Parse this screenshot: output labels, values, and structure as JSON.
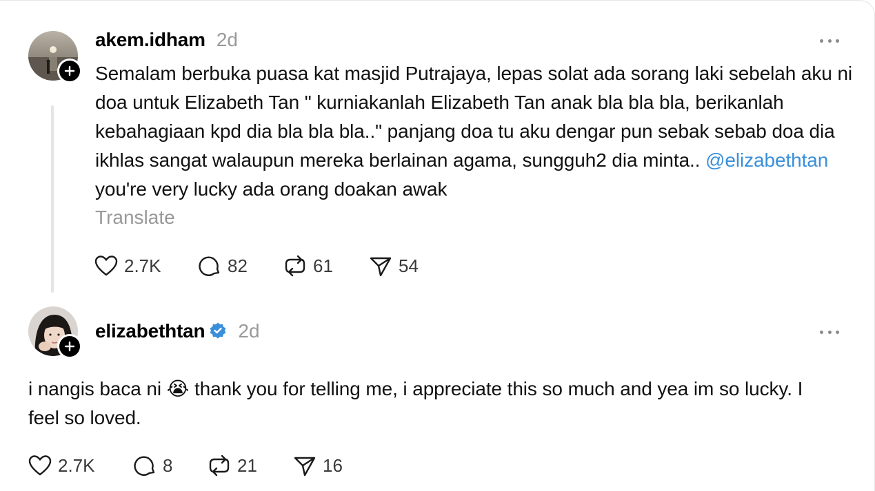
{
  "post1": {
    "username": "akem.idham",
    "time": "2d",
    "avatar_icon": "avatar-sunset-beach",
    "text_part1": "Semalam berbuka puasa kat masjid Putrajaya, lepas solat ada sorang laki sebelah aku ni doa untuk Elizabeth Tan \" kurniakanlah Elizabeth Tan anak bla bla bla, berikanlah kebahagiaan kpd dia bla bla bla..\" panjang doa tu aku dengar pun sebak sebab doa dia ikhlas sangat walaupun mereka berlainan agama, sungguh2 dia minta.. ",
    "mention": "@elizabethtan",
    "text_part2": " you're very lucky ada orang doakan awak",
    "translate": "Translate",
    "likes": "2.7K",
    "replies": "82",
    "reposts": "61",
    "shares": "54"
  },
  "post2": {
    "username": "elizabethtan",
    "verified": true,
    "time": "2d",
    "avatar_icon": "avatar-woman-portrait",
    "text_part1": "i nangis baca ni ",
    "emoji": "😭",
    "text_part2": " thank you for telling me, i appreciate this so much and yea im so lucky. I feel so loved.",
    "likes": "2.7K",
    "replies": "8",
    "reposts": "21",
    "shares": "16"
  },
  "colors": {
    "mention": "#3b8fd9",
    "muted": "#999999",
    "verified": "#3b8fd9",
    "thread_line": "#e5e5e5"
  }
}
